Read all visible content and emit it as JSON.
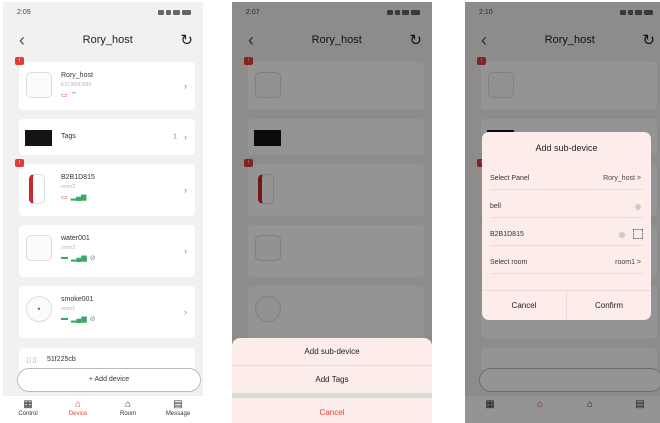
{
  "screens": [
    {
      "time": "2:09",
      "title": "Rory_host",
      "devices": [
        {
          "name": "Rory_host",
          "sub": "E1C900D689"
        },
        {
          "name": "Tags",
          "count": "1"
        },
        {
          "name": "B2B1D815",
          "sub": "room2"
        },
        {
          "name": "water001",
          "sub": "room2"
        },
        {
          "name": "smoke001",
          "sub": "room1"
        },
        {
          "name": "51f225cb"
        }
      ],
      "add_device": "+ Add device",
      "nav": [
        "Control",
        "Device",
        "Room",
        "Message"
      ]
    },
    {
      "time": "2:07",
      "title": "Rory_host",
      "sheet": {
        "options": [
          "Add sub-device",
          "Add Tags"
        ],
        "cancel": "Cancel"
      }
    },
    {
      "time": "2:10",
      "title": "Rory_host",
      "dialog": {
        "title": "Add sub-device",
        "panel_label": "Select Panel",
        "panel_value": "Rory_host >",
        "name_value": "bell",
        "id_value": "B2B1D815",
        "room_label": "Select room",
        "room_value": "room1 >",
        "cancel": "Cancel",
        "confirm": "Confirm"
      }
    }
  ],
  "colors": {
    "accent": "#e0433c",
    "sheet": "#fcecea",
    "bg": "#f3f1f0"
  }
}
